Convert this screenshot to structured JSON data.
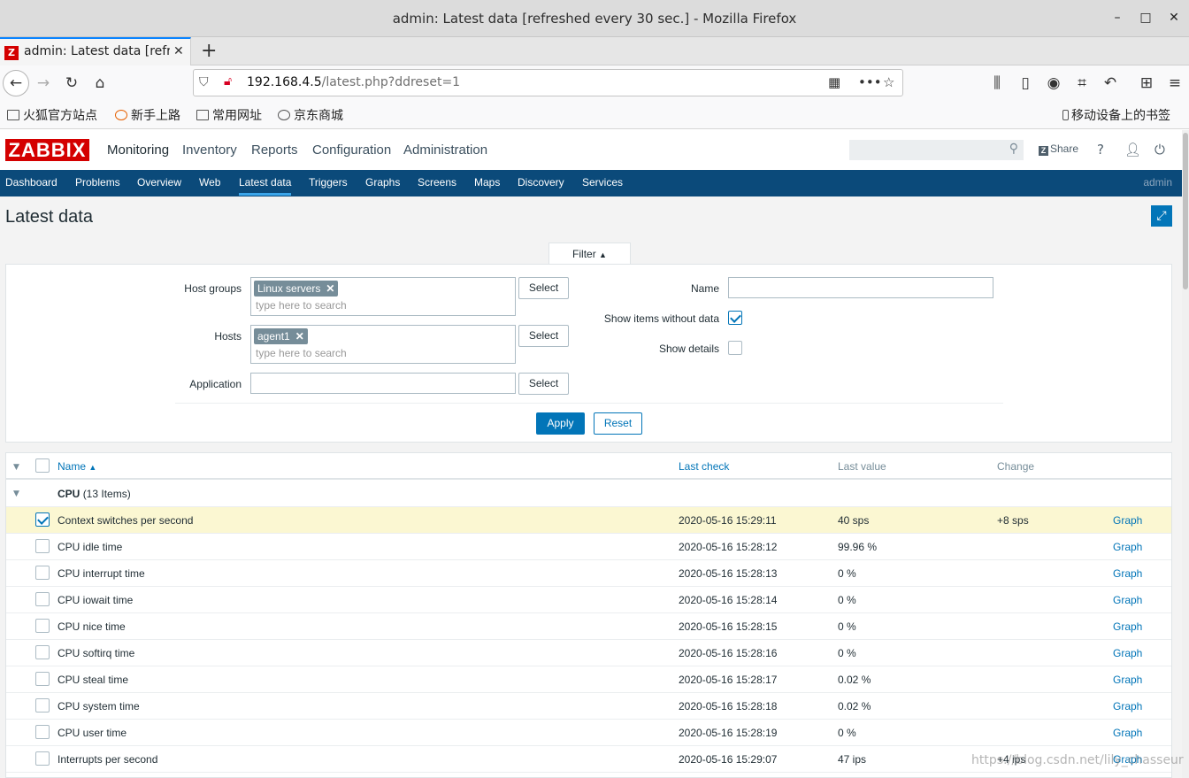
{
  "window": {
    "title": "admin: Latest data [refreshed every 30 sec.] - Mozilla Firefox",
    "tab_label": "admin: Latest data [refres",
    "favicon": "Z"
  },
  "urlbar": {
    "host": "192.168.4.5",
    "path": "/latest.php?ddreset=1"
  },
  "bookmarks": [
    {
      "label": "火狐官方站点",
      "icon": "folder-icon"
    },
    {
      "label": "新手上路",
      "icon": "firefox-icon"
    },
    {
      "label": "常用网址",
      "icon": "folder-icon"
    },
    {
      "label": "京东商城",
      "icon": "globe-icon"
    }
  ],
  "bookmarks_mobile": "移动设备上的书签",
  "zabbix": {
    "logo": "ZABBIX",
    "top_menu": [
      "Monitoring",
      "Inventory",
      "Reports",
      "Configuration",
      "Administration"
    ],
    "share": "Share",
    "help": "?",
    "sub_menu": [
      "Dashboard",
      "Problems",
      "Overview",
      "Web",
      "Latest data",
      "Triggers",
      "Graphs",
      "Screens",
      "Maps",
      "Discovery",
      "Services"
    ],
    "user": "admin",
    "page_title": "Latest data"
  },
  "filter": {
    "tab_label": "Filter",
    "host_groups_label": "Host groups",
    "host_groups_chip": "Linux servers",
    "hosts_label": "Hosts",
    "hosts_chip": "agent1",
    "search_placeholder": "type here to search",
    "application_label": "Application",
    "select_label": "Select",
    "name_label": "Name",
    "show_without_data_label": "Show items without data",
    "show_without_data": true,
    "show_details_label": "Show details",
    "show_details": false,
    "apply": "Apply",
    "reset": "Reset"
  },
  "table": {
    "headers": {
      "name": "Name",
      "last_check": "Last check",
      "last_value": "Last value",
      "change": "Change"
    },
    "group": {
      "name": "CPU",
      "count": "(13 Items)"
    },
    "graph_label": "Graph",
    "rows": [
      {
        "name": "Context switches per second",
        "last_check": "2020-05-16 15:29:11",
        "last_value": "40 sps",
        "change": "+8 sps",
        "checked": true
      },
      {
        "name": "CPU idle time",
        "last_check": "2020-05-16 15:28:12",
        "last_value": "99.96 %",
        "change": "",
        "checked": false
      },
      {
        "name": "CPU interrupt time",
        "last_check": "2020-05-16 15:28:13",
        "last_value": "0 %",
        "change": "",
        "checked": false
      },
      {
        "name": "CPU iowait time",
        "last_check": "2020-05-16 15:28:14",
        "last_value": "0 %",
        "change": "",
        "checked": false
      },
      {
        "name": "CPU nice time",
        "last_check": "2020-05-16 15:28:15",
        "last_value": "0 %",
        "change": "",
        "checked": false
      },
      {
        "name": "CPU softirq time",
        "last_check": "2020-05-16 15:28:16",
        "last_value": "0 %",
        "change": "",
        "checked": false
      },
      {
        "name": "CPU steal time",
        "last_check": "2020-05-16 15:28:17",
        "last_value": "0.02 %",
        "change": "",
        "checked": false
      },
      {
        "name": "CPU system time",
        "last_check": "2020-05-16 15:28:18",
        "last_value": "0.02 %",
        "change": "",
        "checked": false
      },
      {
        "name": "CPU user time",
        "last_check": "2020-05-16 15:28:19",
        "last_value": "0 %",
        "change": "",
        "checked": false
      },
      {
        "name": "Interrupts per second",
        "last_check": "2020-05-16 15:29:07",
        "last_value": "47 ips",
        "change": "+4 ips",
        "checked": false
      }
    ]
  },
  "watermark": "https://blog.csdn.net/lily_chasseur"
}
